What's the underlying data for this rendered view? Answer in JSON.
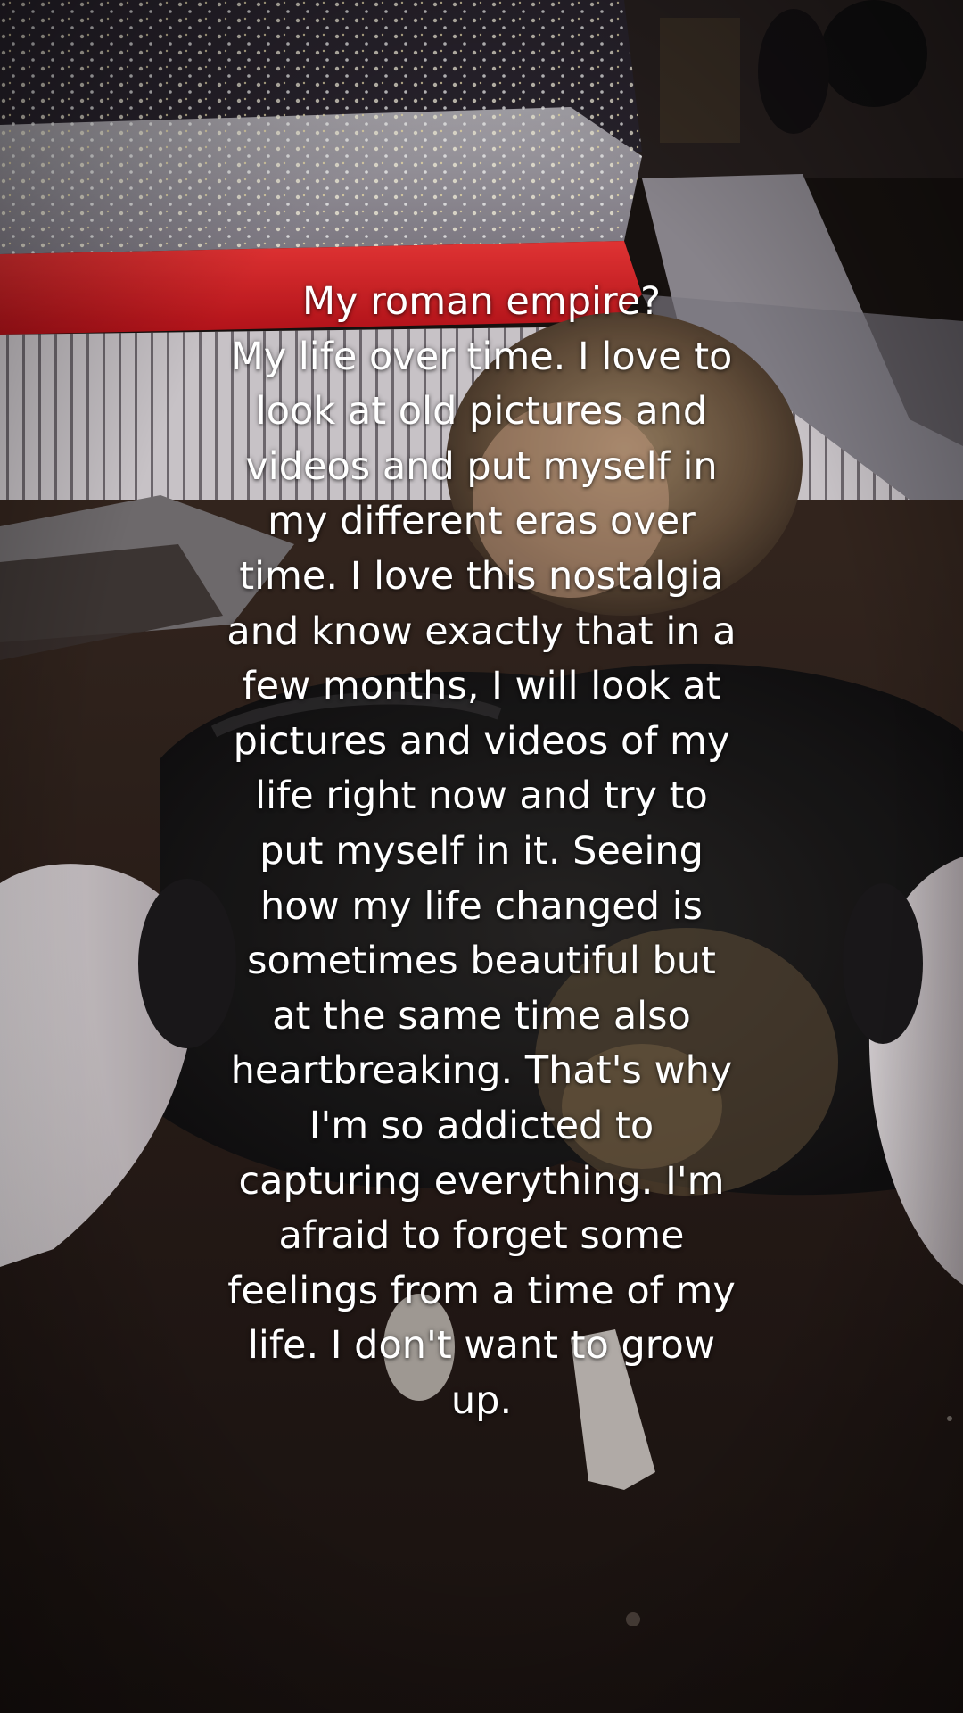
{
  "caption": {
    "lines": [
      "My roman empire?",
      "My life over time. I love to",
      "look at old pictures and",
      "videos and put myself in",
      "my different eras over",
      "time. I love this nostalgia",
      "and know exactly that in a",
      "few months, I will look at",
      "pictures and videos of my",
      "life right now and try to",
      "put myself in it. Seeing",
      "how my life changed is",
      "sometimes beautiful but",
      "at the same time also",
      "heartbreaking. That's why",
      "I'm so addicted to",
      "capturing everything. I'm",
      "afraid to forget some",
      "feelings from a time of my",
      "life. I don't want to grow",
      "up."
    ]
  },
  "scene": {
    "description_colors": {
      "lights_red": "#e8202a",
      "lights_white": "#f2f0e6",
      "coat_dark": "#1b1a1c",
      "sleeve_white": "#d9d2d4",
      "ground": "#2a1e18",
      "hair": "#7a6248"
    }
  }
}
